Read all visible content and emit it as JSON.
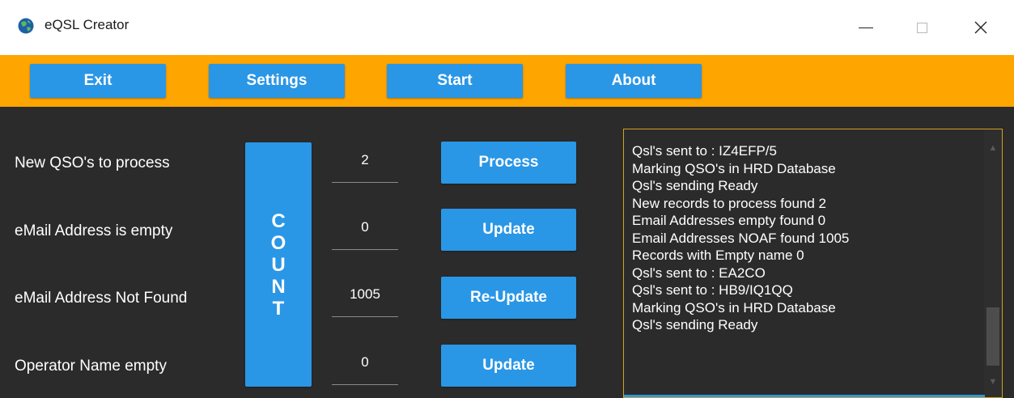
{
  "window": {
    "title": "eQSL Creator"
  },
  "toolbar": {
    "exit_label": "Exit",
    "settings_label": "Settings",
    "start_label": "Start",
    "about_label": "About"
  },
  "rows": [
    {
      "label": "New QSO's to process",
      "value": "2",
      "action": "Process"
    },
    {
      "label": "eMail Address is empty",
      "value": "0",
      "action": "Update"
    },
    {
      "label": "eMail Address Not Found",
      "value": "1005",
      "action": "Re-Update"
    },
    {
      "label": "Operator Name empty",
      "value": "0",
      "action": "Update"
    }
  ],
  "count_button": {
    "letters": [
      "C",
      "O",
      "U",
      "N",
      "T"
    ]
  },
  "log": {
    "lines": [
      "Qsl's sent to : IZ4EFP/5",
      "Marking QSO's in HRD Database",
      "Qsl's sending Ready",
      "New records to process found 2",
      "Email Addresses empty found 0",
      "Email Addresses NOAF found 1005",
      "Records with Empty name 0",
      "Qsl's sent to : EA2CO",
      "Qsl's sent to : HB9/IQ1QQ",
      "Marking QSO's in HRD Database",
      "Qsl's sending Ready"
    ]
  },
  "colors": {
    "toolbar_bg": "#ffa500",
    "button_bg": "#2a96e6",
    "body_bg": "#2b2b2b",
    "log_border": "#d4a020"
  },
  "icons": {
    "app": "globe-icon",
    "minimize": "minimize-icon",
    "maximize": "maximize-icon",
    "close": "close-icon",
    "scroll_up": "scroll-up-arrow-icon",
    "scroll_down": "scroll-down-arrow-icon"
  }
}
